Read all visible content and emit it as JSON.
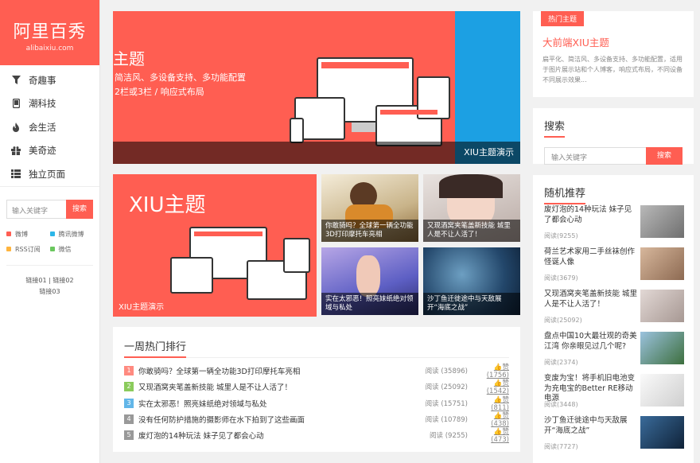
{
  "brand": {
    "name": "阿里百秀",
    "sub": "alibaixiu.com"
  },
  "nav": [
    {
      "label": "奇趣事",
      "icon": "funnel-icon"
    },
    {
      "label": "潮科技",
      "icon": "phone-icon"
    },
    {
      "label": "会生活",
      "icon": "fire-icon"
    },
    {
      "label": "美奇迹",
      "icon": "gift-icon"
    },
    {
      "label": "独立页面",
      "icon": "list-icon"
    }
  ],
  "sidebar_search": {
    "placeholder": "输入关键字",
    "button": "搜索"
  },
  "social": [
    {
      "label": "微博",
      "color": "#ff5e52"
    },
    {
      "label": "腾讯微博",
      "color": "#2cb6e8"
    },
    {
      "label": "RSS订阅",
      "color": "#ffb43d"
    },
    {
      "label": "微信",
      "color": "#6ac75e"
    }
  ],
  "links": {
    "row1": "链接01 | 链接02",
    "row2": "链接03"
  },
  "banner": {
    "title": "主题",
    "line1": "简洁风、多设备支持、多功能配置",
    "line2": "2栏或3栏 / 响应式布局",
    "caption": "XIU主题演示"
  },
  "promo": {
    "title": "XIU主题",
    "caption": "XIU主题演示"
  },
  "thumbs": [
    {
      "caption": "你敢骑吗？全球第一辆全功能3D打印摩托车亮相"
    },
    {
      "caption": "又现酒窝夹笔盖新技能 城里人是不让人活了！"
    },
    {
      "caption": "实在太邪恶！照亮妹纸绝对领域与私处"
    },
    {
      "caption": "沙丁鱼迁徙途中与天敌展开“海底之战”"
    }
  ],
  "hot": {
    "title": "一周热门排行",
    "rows": [
      {
        "num": "1",
        "color": "#ff8a80",
        "title": "你敢骑吗？全球第一辆全功能3D打印摩托车亮相",
        "reads": "阅读 (35896)",
        "likes": "赞 (1756)"
      },
      {
        "num": "2",
        "color": "#8bcb5c",
        "title": "又现酒窝夹笔盖新技能 城里人是不让人活了！",
        "reads": "阅读 (25092)",
        "likes": "赞 (1542)"
      },
      {
        "num": "3",
        "color": "#62b6e8",
        "title": "实在太邪恶！照亮妹纸绝对领域与私处",
        "reads": "阅读 (15751)",
        "likes": "赞 (811)"
      },
      {
        "num": "4",
        "color": "#999999",
        "title": "没有任何防护措施的摄影师在水下拍到了这些画面",
        "reads": "阅读 (10789)",
        "likes": "赞 (438)"
      },
      {
        "num": "5",
        "color": "#999999",
        "title": "废灯泡的14种玩法 妹子见了都会心动",
        "reads": "阅读 (9255)",
        "likes": "赞 (473)"
      }
    ]
  },
  "hot_theme": {
    "tag": "热门主题",
    "title": "大前端XIU主题",
    "desc": "扁平化、简洁风、多设备支持、多功能配置，适用于图片展示站和个人博客，响应式布局，不同设备不同展示效果..."
  },
  "right_search": {
    "title": "搜索",
    "placeholder": "输入关键字",
    "button": "搜索"
  },
  "random": {
    "title": "随机推荐",
    "items": [
      {
        "title": "废灯泡的14种玩法 妹子见了都会心动",
        "views": "阅读(9255)"
      },
      {
        "title": "荷兰艺术家用二手丝袜创作怪诞人像",
        "views": "阅读(3679)"
      },
      {
        "title": "又现酒窝夹笔盖新技能 城里人是不让人活了！",
        "views": "阅读(25092)"
      },
      {
        "title": "盘点中国10大最壮观的奇美江湾 你亲眼见过几个呢?",
        "views": "阅读(2374)"
      },
      {
        "title": "变废为宝！将手机旧电池变为充电宝的Better RE移动电源",
        "views": "阅读(3448)"
      },
      {
        "title": "沙丁鱼迁徙途中与天敌展开“海底之战”",
        "views": "阅读(7727)"
      }
    ]
  },
  "colors": {
    "accent": "#ff5e52",
    "blue": "#1ca0e3"
  }
}
